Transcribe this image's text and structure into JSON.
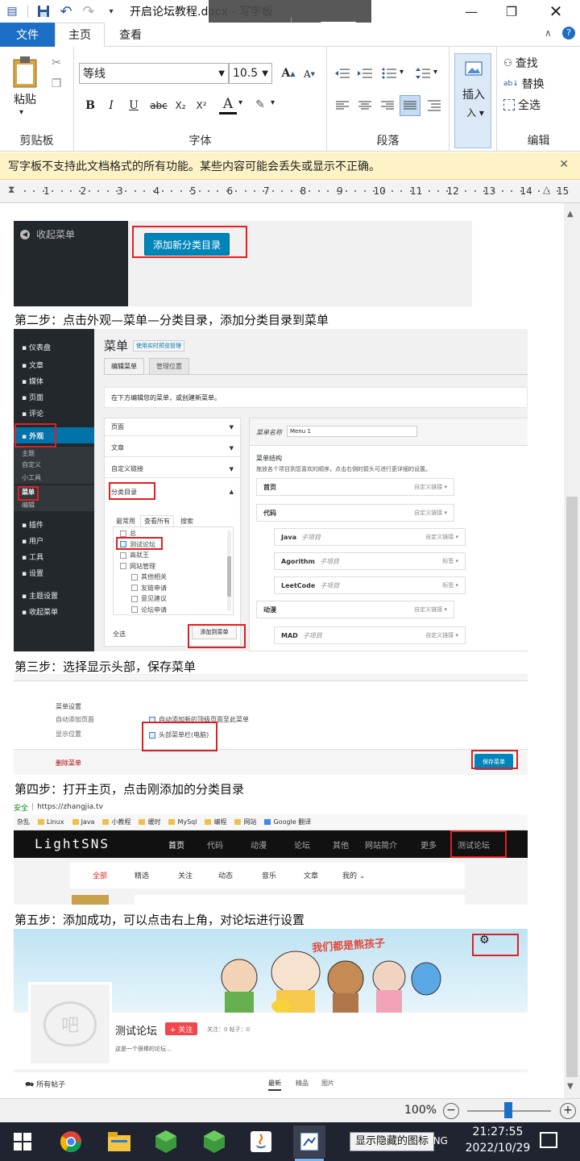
{
  "app": {
    "window_title": "开启论坛教程.docx - 写字板"
  },
  "tabs": {
    "file": "文件",
    "home": "主页",
    "view": "查看"
  },
  "ribbon": {
    "clipboard": {
      "paste": "粘贴",
      "label": "剪贴板"
    },
    "font": {
      "family": "等线",
      "size": "10.5",
      "label": "字体",
      "bold": "B",
      "italic": "I",
      "underline": "U",
      "strike": "abc",
      "sub": "X₂",
      "sup": "X²",
      "color_a": "A",
      "grow": "A",
      "shrink": "A"
    },
    "paragraph": {
      "label": "段落"
    },
    "insert": {
      "label": "插入"
    },
    "editing": {
      "find": "查找",
      "replace": "替换",
      "select_all": "全选",
      "label": "编辑"
    }
  },
  "warning": {
    "text": "写字板不支持此文档格式的所有功能。某些内容可能会丢失或显示不正确。"
  },
  "ruler": {
    "ticks": [
      "1",
      "2",
      "3",
      "4",
      "5",
      "6",
      "7",
      "8",
      "9",
      "10",
      "11",
      "12",
      "13",
      "14",
      "15"
    ]
  },
  "doc": {
    "img1": {
      "collapse_menu": "收起菜单",
      "add_button": "添加新分类目录"
    },
    "step2": "第二步：点击外观—菜单—分类目录，添加分类目录到菜单",
    "img2": {
      "sidebar": [
        "仪表盘",
        "文章",
        "媒体",
        "页面",
        "评论",
        "外观",
        "主题",
        "自定义",
        "小工具",
        "菜单",
        "编辑",
        "插件",
        "用户",
        "工具",
        "设置",
        "主题设置",
        "收起菜单"
      ],
      "title": "菜单",
      "title_link": "使用实时预览管理",
      "tab_edit": "编辑菜单",
      "tab_manage": "管理位置",
      "hint": "在下方编辑您的菜单，或创建新菜单。",
      "left_rows": [
        "页面",
        "文章",
        "自定义链接",
        "分类目录"
      ],
      "cat_tabs": [
        "最常用",
        "查看所有",
        "搜索"
      ],
      "cat_items": [
        "总",
        "测试论坛",
        "高就王",
        "网站管理",
        "其他相关",
        "友链申请",
        "意见建议",
        "论坛申请"
      ],
      "select_all": "全选",
      "add_to_menu": "添加到菜单",
      "menu_name_label": "菜单名称",
      "menu_name_value": "Menu 1",
      "structure_title": "菜单结构",
      "structure_hint": "拖放各个项目到您喜欢的顺序，点击右侧的箭头可进行更详细的设置。",
      "menu_items": [
        {
          "name": "首页",
          "type": "自定义链接",
          "sub": ""
        },
        {
          "name": "代码",
          "type": "自定义链接",
          "sub": ""
        },
        {
          "name": "Java",
          "type": "自定义链接",
          "sub": "子项目"
        },
        {
          "name": "Agorithm",
          "type": "标签",
          "sub": "子项目"
        },
        {
          "name": "LeetCode",
          "type": "标签",
          "sub": "子项目"
        },
        {
          "name": "动漫",
          "type": "自定义链接",
          "sub": ""
        },
        {
          "name": "MAD",
          "type": "自定义链接",
          "sub": "子项目"
        }
      ]
    },
    "step3": "第三步：选择显示头部，保存菜单",
    "img3": {
      "settings_title": "菜单设置",
      "auto_add_label": "自动添加页面",
      "auto_add_text": "自动添加新的顶级页面至此菜单",
      "location_label": "显示位置",
      "location_text": "头部菜单栏(电脑)",
      "delete": "删除菜单",
      "save": "保存菜单"
    },
    "step4": "第四步：打开主页，点击刚添加的分类目录",
    "img4": {
      "secure": "安全",
      "url": "https://zhangjia.tv",
      "bookmarks": [
        "杂乱",
        "Linux",
        "Java",
        "小教程",
        "缓时",
        "MySql",
        "编程",
        "网站",
        "Google 翻译"
      ],
      "logo": "LightSNS",
      "nav": [
        "首页",
        "代码",
        "动漫",
        "论坛",
        "其他",
        "网站简介",
        "更多",
        "测试论坛"
      ],
      "subnav": [
        "全部",
        "精选",
        "关注",
        "动态",
        "音乐",
        "文章",
        "我的"
      ]
    },
    "step5": "第五步：添加成功，可以点击右上角，对论坛进行设置",
    "img5": {
      "banner_text": "我们都是熊孩子",
      "avatar_text": "吧",
      "forum_name": "测试论坛",
      "follow": "+ 关注",
      "stats": "关注：0   帖子：0",
      "desc": "这是一个很棒的论坛...",
      "all_posts": "所有帖子",
      "tabs": [
        "最新",
        "精品",
        "图片"
      ]
    }
  },
  "status": {
    "zoom": "100%"
  },
  "taskbar": {
    "time": "21:27:55",
    "date": "2022/10/29",
    "lang": "ENG",
    "tooltip": "显示隐藏的图标"
  },
  "colors": {
    "accent": "#1c6fc4",
    "wp_blue": "#0073aa",
    "red": "#e02020",
    "follow_red": "#f0474d"
  }
}
